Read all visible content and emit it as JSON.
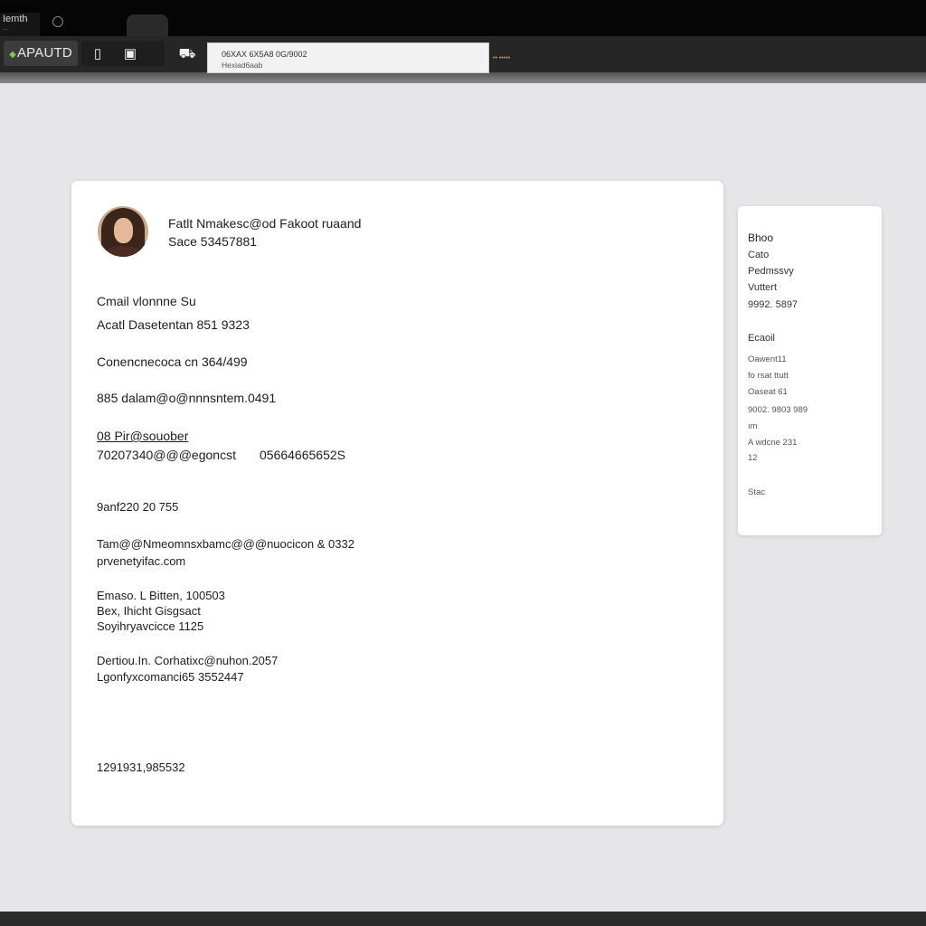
{
  "browser": {
    "tabs": [
      {
        "label": "Iemth",
        "sub": "..."
      }
    ],
    "brand_label": "APAUTD",
    "url_line1": "06XAX 6X5A8 0G/9002",
    "url_line2": "Hexiad6aab",
    "status_text": "•• •••••",
    "tool_icons": [
      "document-icon",
      "gallery-icon",
      "car-icon"
    ]
  },
  "profile": {
    "name": "Fatlt Nmakesc@od Fakoot ruaand",
    "id": "Sace 53457881"
  },
  "details": {
    "line1": "Cmail vlonnne Su",
    "line2": "Acatl Dasetentan 851 9323",
    "line3": "Conencnecoca cn 364/499",
    "line4": "885 dalam@o@nnnsntem.0491",
    "line5a": "08 Pir@souober",
    "line5b": "70207340@@@egoncst",
    "line5c": "05664665652S",
    "line6": "9anf220 20 755",
    "line7a": "Tam@@Nmeomnsxbamc@@@nuocicon & 0332",
    "line7b": "prvenetyifac.com",
    "line8a": "Emaso. L Bitten, 100503",
    "line8b": "Bex, Ihicht Gisgsact",
    "line8c": "Soyihryavcicce 1125",
    "line9a": "Dertiou.In. Corhatixc@nuhon.2057",
    "line9b": "Lgonfyxcomanci65 3552447",
    "footer": "1291931,985532"
  },
  "sidebar": {
    "group1": [
      "Bhoo",
      "Cato",
      "Pedmssvy",
      "Vuttert",
      "9992. 5897"
    ],
    "group2_head": "Ecaoil",
    "group2": [
      "Oawent11",
      "fo rsat ttutt",
      "Oaseat 61",
      "9002. 9803 989",
      "ım",
      "A wdcne 231",
      "12"
    ],
    "footer": "Stac"
  }
}
